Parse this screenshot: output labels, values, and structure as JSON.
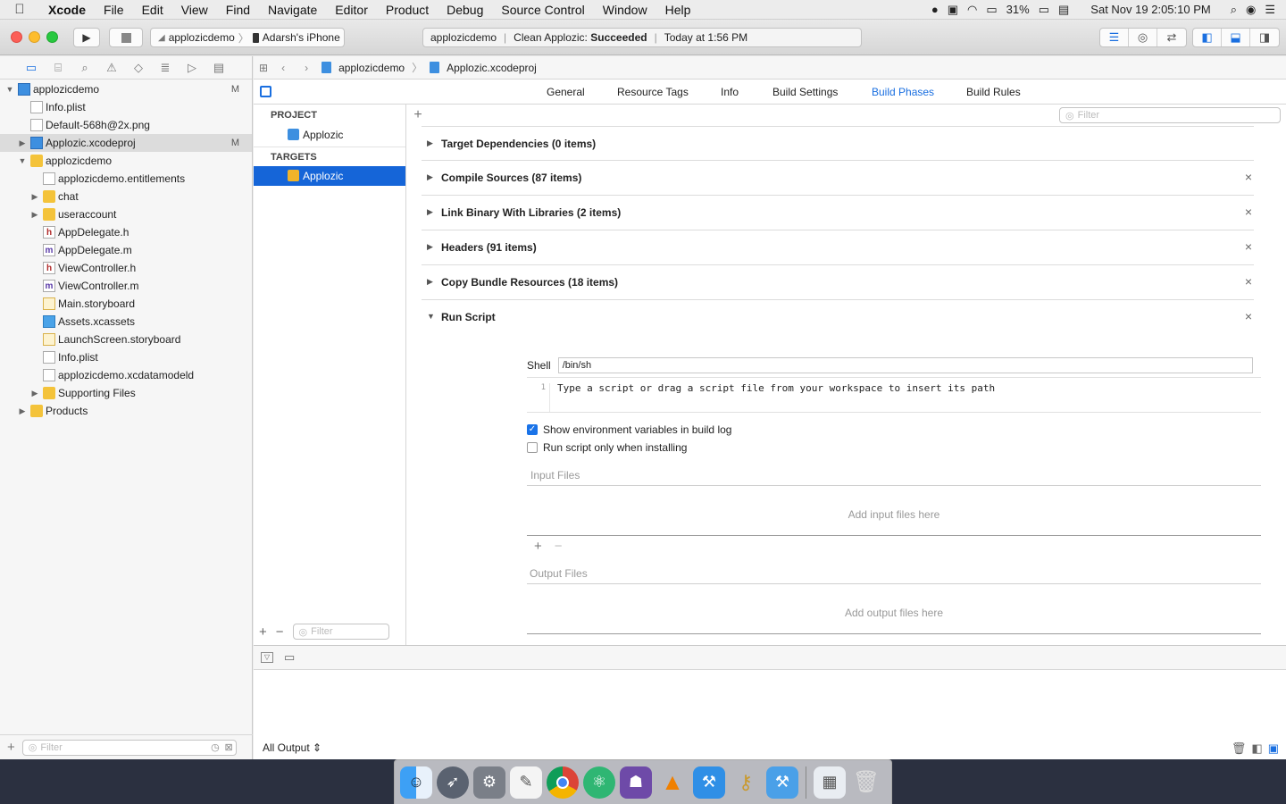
{
  "menubar": {
    "app_name": "Xcode",
    "items": [
      "File",
      "Edit",
      "View",
      "Find",
      "Navigate",
      "Editor",
      "Product",
      "Debug",
      "Source Control",
      "Window",
      "Help"
    ],
    "battery": "31%",
    "clock": "Sat Nov 19  2:05:10 PM"
  },
  "toolbar": {
    "scheme": "applozicdemo",
    "device": "Adarsh's iPhone",
    "activity_project": "applozicdemo",
    "activity_status_prefix": "Clean Applozic:",
    "activity_status": "Succeeded",
    "activity_time": "Today at 1:56 PM"
  },
  "navigator": {
    "rows": [
      {
        "label": "applozicdemo",
        "badge": "M"
      },
      {
        "label": "Info.plist",
        "badge": ""
      },
      {
        "label": "Default-568h@2x.png",
        "badge": ""
      },
      {
        "label": "Applozic.xcodeproj",
        "badge": "M"
      },
      {
        "label": "applozicdemo",
        "badge": ""
      },
      {
        "label": "applozicdemo.entitlements",
        "badge": ""
      },
      {
        "label": "chat",
        "badge": ""
      },
      {
        "label": "useraccount",
        "badge": ""
      },
      {
        "label": "AppDelegate.h",
        "badge": ""
      },
      {
        "label": "AppDelegate.m",
        "badge": ""
      },
      {
        "label": "ViewController.h",
        "badge": ""
      },
      {
        "label": "ViewController.m",
        "badge": ""
      },
      {
        "label": "Main.storyboard",
        "badge": ""
      },
      {
        "label": "Assets.xcassets",
        "badge": ""
      },
      {
        "label": "LaunchScreen.storyboard",
        "badge": ""
      },
      {
        "label": "Info.plist",
        "badge": ""
      },
      {
        "label": "applozicdemo.xcdatamodeld",
        "badge": ""
      },
      {
        "label": "Supporting Files",
        "badge": ""
      },
      {
        "label": "Products",
        "badge": ""
      }
    ],
    "filter_placeholder": "Filter"
  },
  "jumpbar": {
    "crumb1": "applozicdemo",
    "crumb2": "Applozic.xcodeproj"
  },
  "tabs": [
    "General",
    "Resource Tags",
    "Info",
    "Build Settings",
    "Build Phases",
    "Build Rules"
  ],
  "targets": {
    "project_header": "PROJECT",
    "project_item": "Applozic",
    "targets_header": "TARGETS",
    "target_item": "Applozic",
    "filter_placeholder": "Filter"
  },
  "phases": {
    "filter_placeholder": "Filter",
    "items": [
      "Target Dependencies (0 items)",
      "Compile Sources (87 items)",
      "Link Binary With Libraries (2 items)",
      "Headers (91 items)",
      "Copy Bundle Resources (18 items)",
      "Run Script"
    ]
  },
  "run_script": {
    "shell_label": "Shell",
    "shell_value": "/bin/sh",
    "line_no": "1",
    "code": "Type a script or drag a script file from your workspace to insert its path",
    "opt1": "Show environment variables in build log",
    "opt1_checked": true,
    "opt2": "Run script only when installing",
    "opt2_checked": false,
    "input_label": "Input Files",
    "input_empty": "Add input files here",
    "output_label": "Output Files",
    "output_empty": "Add output files here"
  },
  "debug": {
    "output_selector": "All Output ⇕"
  }
}
